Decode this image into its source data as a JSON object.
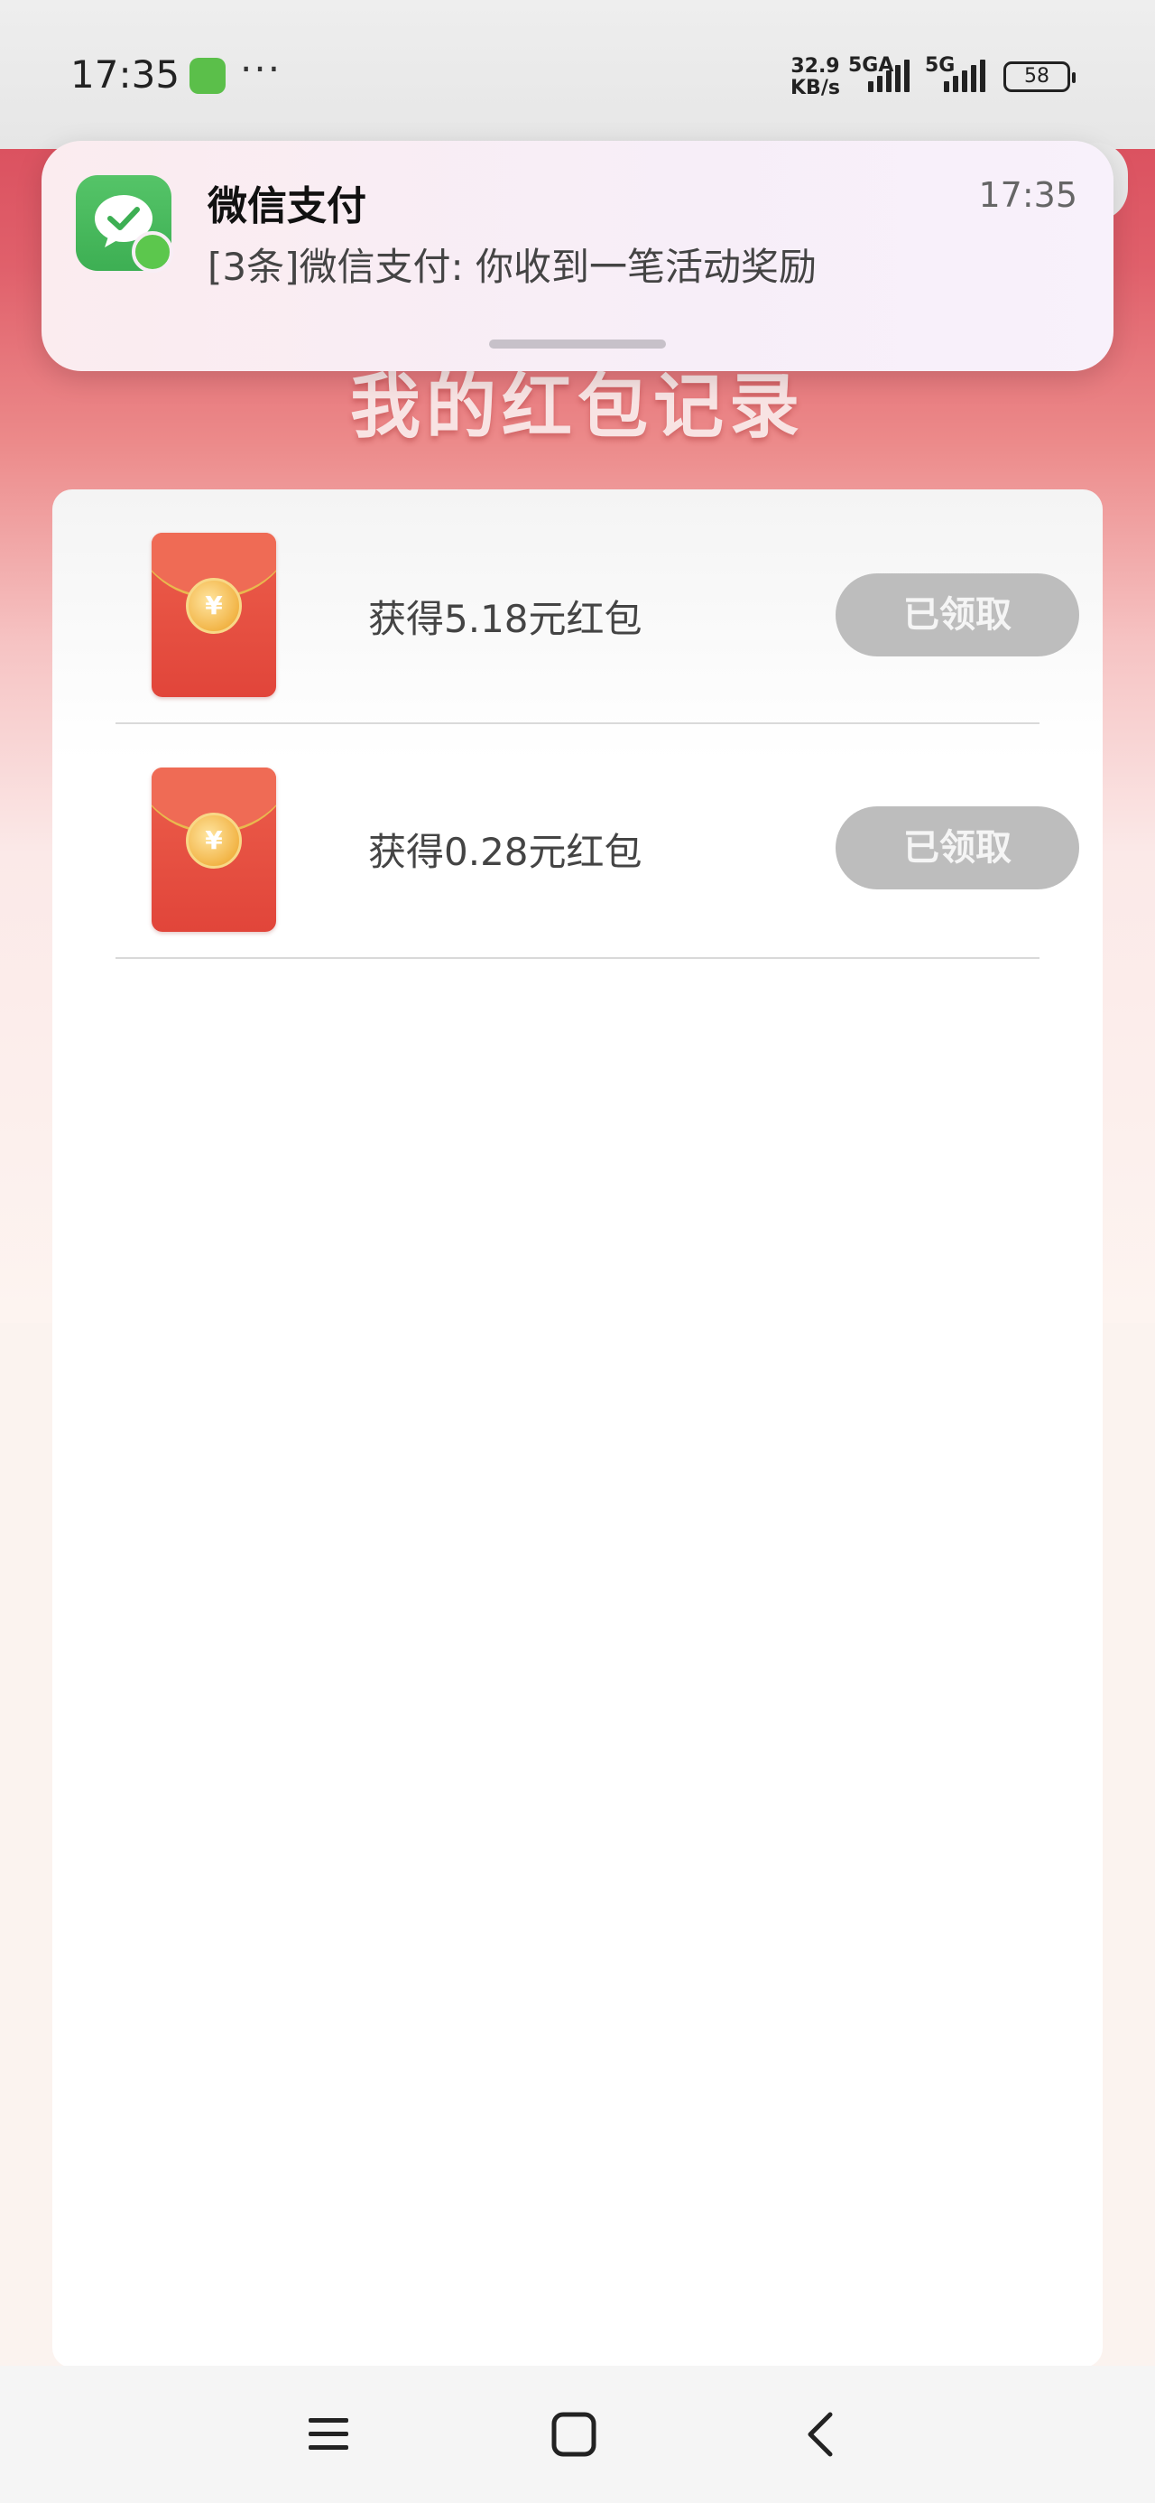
{
  "status_bar": {
    "time": "17:35",
    "more_dots": "···",
    "net_speed_value": "32.9",
    "net_speed_unit": "KB/s",
    "net1_label": "5GA",
    "net2_label": "5G",
    "battery": "58"
  },
  "notification": {
    "app_name": "微信支付",
    "time": "17:35",
    "body": "[3条]微信支付: 你收到一笔活动奖励",
    "icon": "wechat-pay-icon"
  },
  "page": {
    "title": "我的红包记录"
  },
  "records": [
    {
      "label": "获得5.18元红包",
      "button": "已领取",
      "icon": "red-envelope-icon",
      "coin": "¥"
    },
    {
      "label": "获得0.28元红包",
      "button": "已领取",
      "icon": "red-envelope-icon",
      "coin": "¥"
    }
  ],
  "navbar": {
    "menu_icon": "menu-icon",
    "home_icon": "home-icon",
    "back_icon": "back-icon"
  },
  "colors": {
    "header_red": "#db5260",
    "claimed_button": "#bdbdbd",
    "envelope_red": "#e1453a",
    "coin_gold": "#f2b548",
    "wechat_green": "#3daf53"
  }
}
